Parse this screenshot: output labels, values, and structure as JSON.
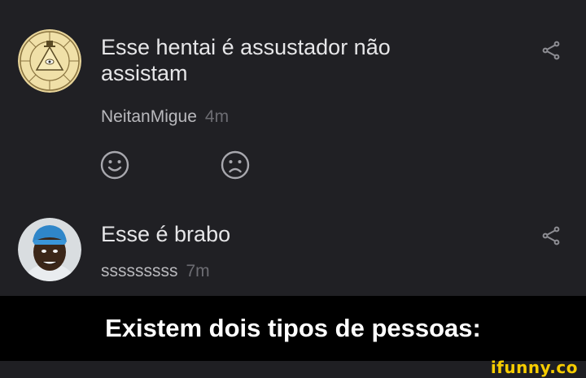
{
  "comments": [
    {
      "text": "Esse hentai é assustador não\nassistam",
      "username": "NeitanMigue",
      "time": "4m",
      "avatar_icon": "bill-cipher-wheel-icon"
    },
    {
      "text": "Esse é brabo",
      "username": "sssssssss",
      "time": "7m",
      "avatar_icon": "user-photo-avatar"
    }
  ],
  "reactions": [
    "smile-icon",
    "frown-icon"
  ],
  "caption": "Existem dois tipos de pessoas:",
  "watermark": "ifunny.co",
  "colors": {
    "background": "#202024",
    "caption_bar": "#000000",
    "watermark": "#f6cc00",
    "text": "#e6e6e8",
    "muted": "#6c6c72"
  }
}
